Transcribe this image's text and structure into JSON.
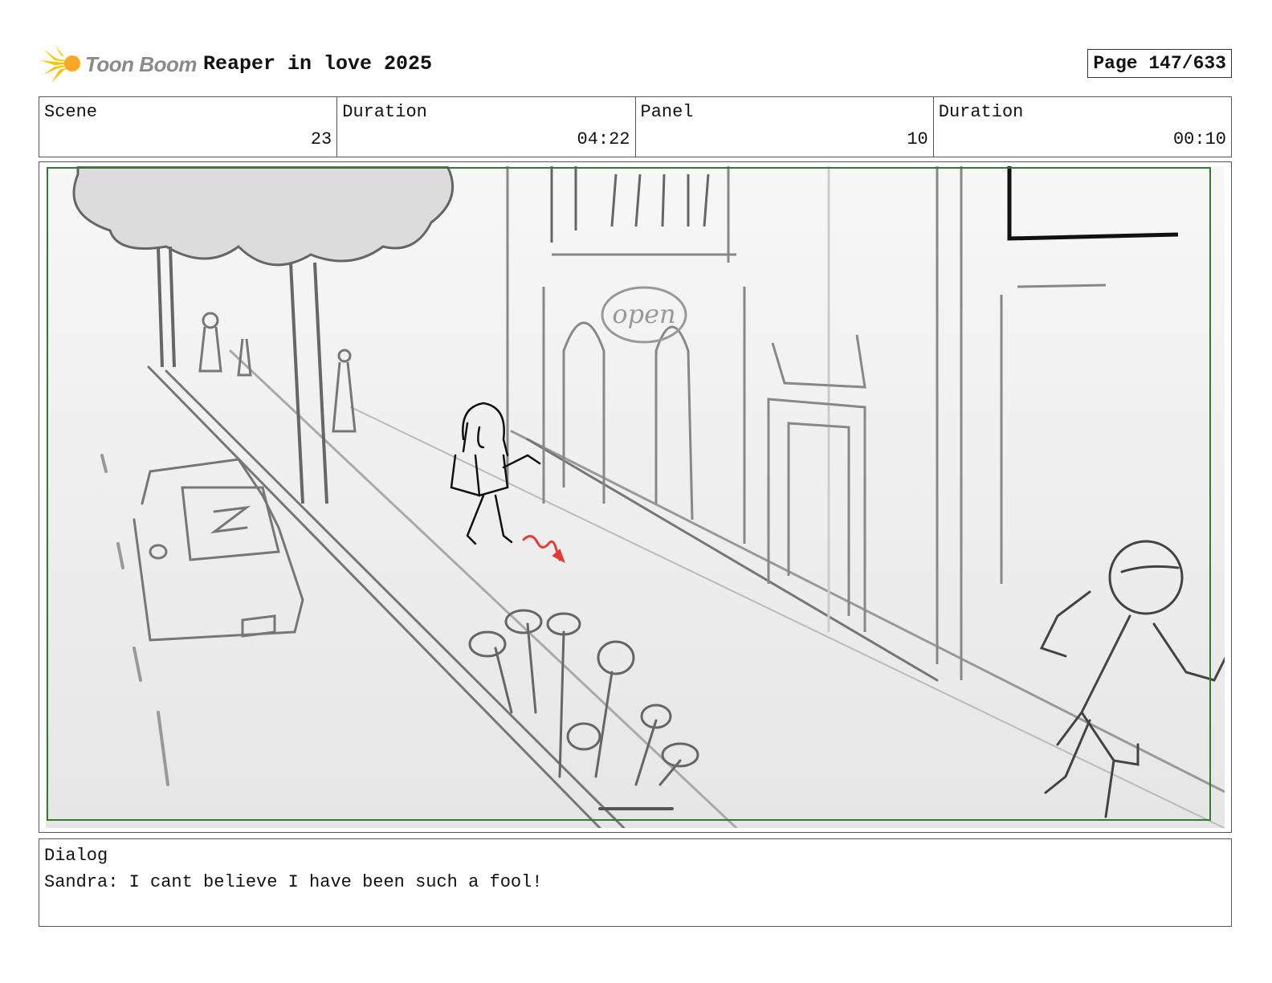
{
  "header": {
    "brand": "Toon Boom",
    "project_title": "Reaper in love 2025",
    "page": "Page 147/633"
  },
  "info": {
    "scene_label": "Scene",
    "scene_value": "23",
    "scene_duration_label": "Duration",
    "scene_duration_value": "04:22",
    "panel_label": "Panel",
    "panel_value": "10",
    "panel_duration_label": "Duration",
    "panel_duration_value": "00:10"
  },
  "panel": {
    "sign_text": "open"
  },
  "dialog": {
    "label": "Dialog",
    "text": "Sandra: I cant believe I have been such a fool!"
  },
  "colors": {
    "frame_green": "#2e7d32",
    "sketch_gray": "#6b6b6b",
    "action_red": "#e53935",
    "logo_yellow": "#f6c500"
  }
}
